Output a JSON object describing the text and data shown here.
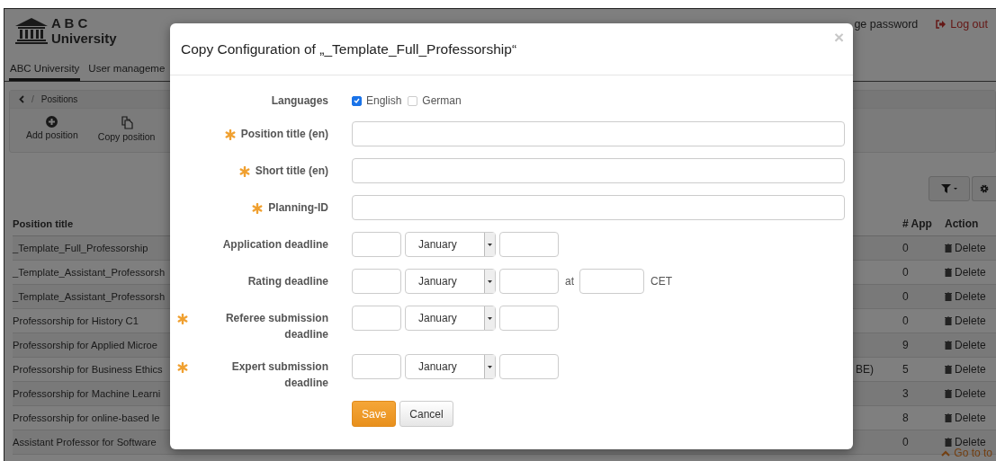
{
  "header": {
    "logo": {
      "line1": "A B C",
      "line2": "University"
    },
    "links": [
      {
        "text": "ge password",
        "kind": "plain"
      },
      {
        "text": "Log out",
        "kind": "logout"
      }
    ]
  },
  "tabs": [
    {
      "label": "ABC University",
      "selected": true
    },
    {
      "label": "User manageme",
      "selected": false
    }
  ],
  "breadcrumb": {
    "separator": "/",
    "current": "Positions"
  },
  "toolbar": [
    {
      "label": "Add position",
      "kind": "add"
    },
    {
      "label": "Copy position",
      "kind": "copy"
    }
  ],
  "table": {
    "columns": [
      "Position title",
      "# App",
      "Action"
    ],
    "rows": [
      {
        "title": "_Template_Full_Professorship",
        "apps": "0",
        "action": "Delete"
      },
      {
        "title": "_Template_Assistant_Professorsh",
        "apps": "0",
        "action": "Delete"
      },
      {
        "title": "_Template_Assistant_Professorsh",
        "apps": "0",
        "action": "Delete"
      },
      {
        "title": "Professorship for History C1",
        "apps": "0",
        "action": "Delete"
      },
      {
        "title": "Professorship for Applied Microe",
        "apps": "9",
        "action": "Delete"
      },
      {
        "title": "Professorship for Business Ethics",
        "column_2": "BE)",
        "apps": "5",
        "action": "Delete"
      },
      {
        "title": "Professorship for Machine Learni",
        "apps": "3",
        "action": "Delete"
      },
      {
        "title": "Professorship for online-based le",
        "apps": "8",
        "action": "Delete"
      },
      {
        "title": "Assistant Professor for Software",
        "apps": "0",
        "action": "Delete"
      }
    ]
  },
  "go_to_top": "Go to to",
  "modal": {
    "title": "Copy Configuration of „_Template_Full_Professorship“",
    "close": "×",
    "fields": [
      {
        "kind": "languages",
        "label": "Languages",
        "required": false,
        "options": [
          {
            "label": "English",
            "checked": true
          },
          {
            "label": "German",
            "checked": false
          }
        ]
      },
      {
        "kind": "text",
        "label": "Position title (en)",
        "required": true
      },
      {
        "kind": "text",
        "label": "Short title (en)",
        "required": true
      },
      {
        "kind": "text",
        "label": "Planning-ID",
        "required": true
      },
      {
        "kind": "date",
        "label": "Application deadline",
        "required": false,
        "month": "January"
      },
      {
        "kind": "datetime",
        "label": "Rating deadline",
        "required": false,
        "month": "January",
        "at": "at",
        "timezone": "CET"
      },
      {
        "kind": "date",
        "label": "Referee submission deadline",
        "required": true,
        "month": "January"
      },
      {
        "kind": "date",
        "label": "Expert submission deadline",
        "required": true,
        "month": "January"
      }
    ],
    "buttons": [
      {
        "label": "Save",
        "kind": "primary"
      },
      {
        "label": "Cancel",
        "kind": "default"
      }
    ]
  }
}
